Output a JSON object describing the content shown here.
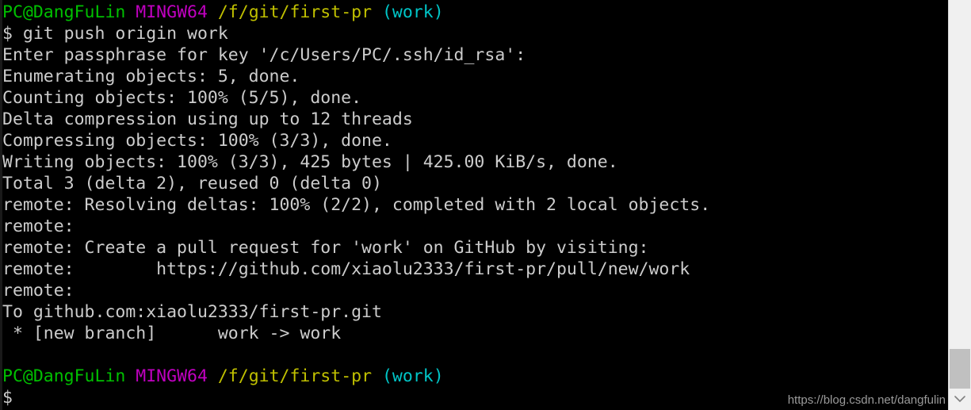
{
  "terminal": {
    "prompt": {
      "user_host": "PC@DangFuLin",
      "shell": "MINGW64",
      "path": "/f/git/first-pr",
      "branch": "(work)",
      "symbol": "$",
      "command": " git push origin work"
    },
    "colors": {
      "background": "#000000",
      "foreground": "#cccccc",
      "user_host": "#00c000",
      "shell": "#c000c0",
      "path": "#c0c000",
      "branch": "#00c5c7"
    },
    "output_lines": [
      "Enter passphrase for key '/c/Users/PC/.ssh/id_rsa':",
      "Enumerating objects: 5, done.",
      "Counting objects: 100% (5/5), done.",
      "Delta compression using up to 12 threads",
      "Compressing objects: 100% (3/3), done.",
      "Writing objects: 100% (3/3), 425 bytes | 425.00 KiB/s, done.",
      "Total 3 (delta 2), reused 0 (delta 0)",
      "remote: Resolving deltas: 100% (2/2), completed with 2 local objects.",
      "remote:",
      "remote: Create a pull request for 'work' on GitHub by visiting:",
      "remote:        https://github.com/xiaolu2333/first-pr/pull/new/work",
      "remote:",
      "To github.com:xiaolu2333/first-pr.git",
      " * [new branch]      work -> work",
      ""
    ],
    "final_prompt_symbol": "$"
  },
  "scrollbar": {
    "down_arrow_icon": "chevron-down-icon"
  },
  "watermark": {
    "text": "https://blog.csdn.net/dangfulin"
  }
}
